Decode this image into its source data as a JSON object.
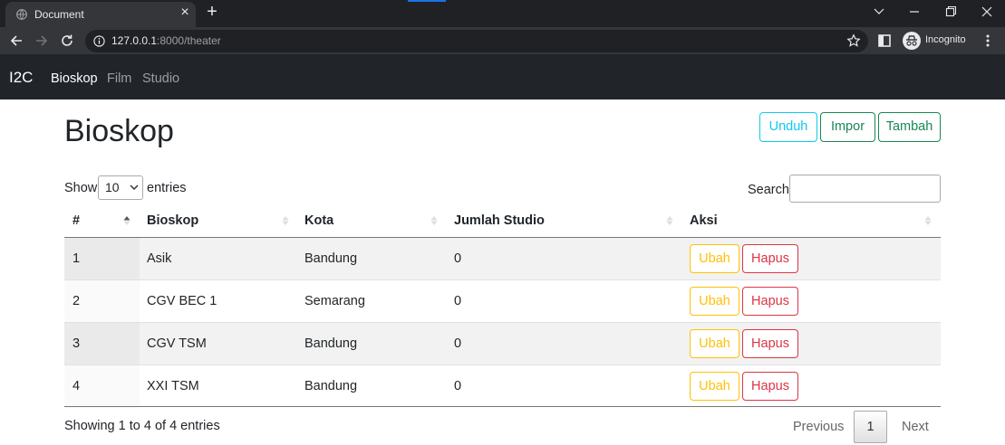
{
  "browser": {
    "tab_title": "Document",
    "url_host": "127.0.0.1",
    "url_path": ":8000/theater",
    "profile_label": "Incognito"
  },
  "navbar": {
    "brand": "I2C",
    "links": [
      "Bioskop",
      "Film",
      "Studio"
    ],
    "active": "Bioskop"
  },
  "page": {
    "title": "Bioskop",
    "actions": {
      "download": "Unduh",
      "import": "Impor",
      "add": "Tambah"
    }
  },
  "table_controls": {
    "show_label": "Show",
    "page_length": "10",
    "entries_label": "entries",
    "search_label": "Search:",
    "search_value": ""
  },
  "table": {
    "columns": [
      "#",
      "Bioskop",
      "Kota",
      "Jumlah Studio",
      "Aksi"
    ],
    "rows": [
      {
        "no": "1",
        "name": "Asik",
        "city": "Bandung",
        "studios": "0"
      },
      {
        "no": "2",
        "name": "CGV BEC 1",
        "city": "Semarang",
        "studios": "0"
      },
      {
        "no": "3",
        "name": "CGV TSM",
        "city": "Bandung",
        "studios": "0"
      },
      {
        "no": "4",
        "name": "XXI TSM",
        "city": "Bandung",
        "studios": "0"
      }
    ],
    "edit_label": "Ubah",
    "delete_label": "Hapus"
  },
  "footer": {
    "info": "Showing 1 to 4 of 4 entries",
    "prev": "Previous",
    "current_page": "1",
    "next": "Next"
  },
  "colors": {
    "navbar_bg": "#212529",
    "info": "#0dcaf0",
    "success": "#198754",
    "warning": "#ffc107",
    "danger": "#dc3545"
  }
}
